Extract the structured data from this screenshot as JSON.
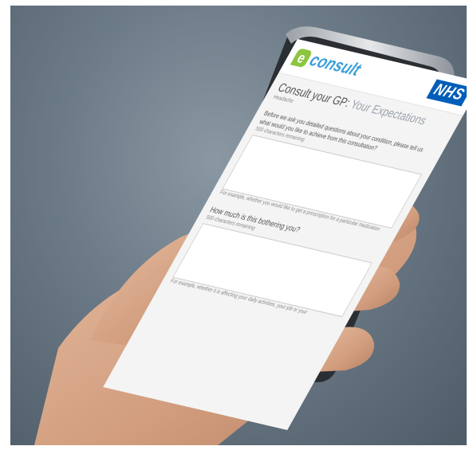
{
  "scene": {
    "description_colors": {
      "background": "#6b7a86",
      "phone_frame": "#c9ccd0",
      "skin": "#d9a887"
    }
  },
  "app": {
    "logo_mark": "e",
    "logo_text": "consult",
    "partner_logo": "NHS",
    "title_main": "Consult your GP:",
    "title_sub": "Your Expectations",
    "subtitle": "Headache",
    "question1": "Before we ask you detailed questions about your condition, please tell us what would you like to achieve from this consultation?",
    "chars_remaining": "500 characters remaining",
    "hint1": "For example, whether you would like to get a prescription for a particular medication",
    "question2": "How much is this bothering you?",
    "hint2": "For example, whether it is affecting your daily activities, your job or your"
  }
}
